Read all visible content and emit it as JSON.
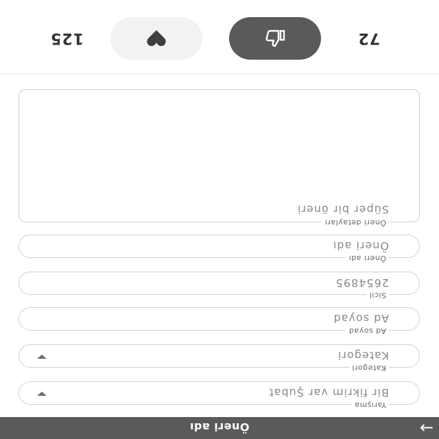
{
  "header": {
    "title": "Öneri adı",
    "back_icon": "arrow-right-icon"
  },
  "form": {
    "competition": {
      "label": "Yarışma",
      "value": "Bir fikrim var Şubat"
    },
    "category": {
      "label": "Kategori",
      "value": "Kategori"
    },
    "full_name": {
      "label": "Ad soyad",
      "placeholder": "Ad soyad"
    },
    "registry": {
      "label": "Sicil",
      "value": "2654895"
    },
    "suggestion_name": {
      "label": "Öneri adı",
      "placeholder": "Öneri adı"
    },
    "suggestion_details": {
      "label": "Öneri detayları",
      "placeholder": "Süper bir öneri"
    }
  },
  "reactions": {
    "likes": "72",
    "hearts": "125",
    "like_icon": "thumbs-up-icon",
    "heart_icon": "heart-icon"
  }
}
